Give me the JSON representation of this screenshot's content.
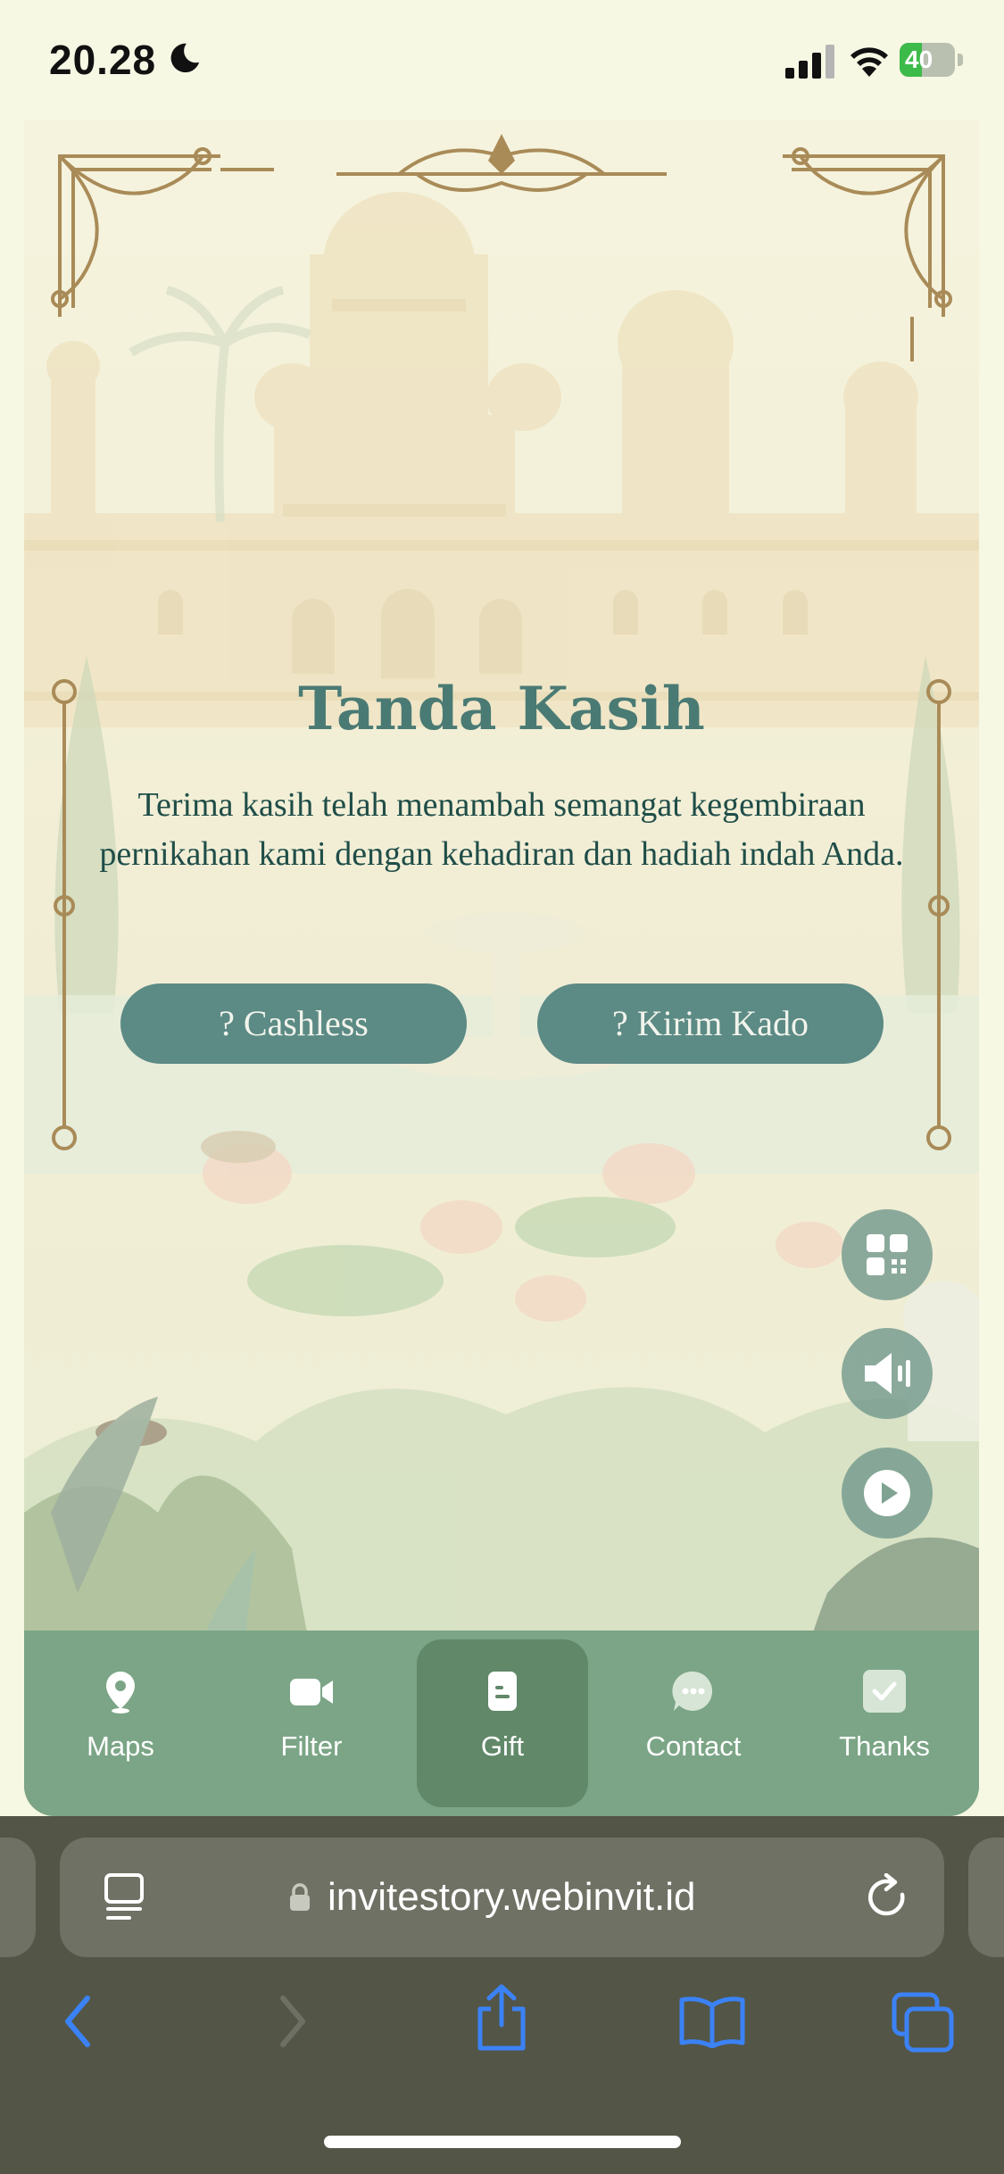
{
  "status_bar": {
    "time": "20.28",
    "battery": "40",
    "battery_level": 0.4
  },
  "invitation": {
    "title": "Tanda Kasih",
    "message": "Terima kasih telah menambah semangat kegembiraan pernikahan kami dengan kehadiran dan hadiah indah Anda.",
    "buttons": {
      "cashless": "? Cashless",
      "kirim_kado": "? Kirim Kado"
    }
  },
  "bottom_nav": {
    "active": "Gift",
    "items": [
      {
        "label": "Maps",
        "icon": "map-pin-icon"
      },
      {
        "label": "Filter",
        "icon": "video-camera-icon"
      },
      {
        "label": "Gift",
        "icon": "gift-card-icon"
      },
      {
        "label": "Contact",
        "icon": "chat-bubble-icon"
      },
      {
        "label": "Thanks",
        "icon": "check-square-icon"
      }
    ]
  },
  "floating_buttons": [
    {
      "icon": "qr-code-icon"
    },
    {
      "icon": "speaker-icon"
    },
    {
      "icon": "play-icon"
    }
  ],
  "browser": {
    "url": "invitestory.webinvit.id"
  },
  "colors": {
    "accent": "#5c8a84",
    "nav_background": "#7ba586",
    "nav_active": "#608869",
    "title": "#4a7a74",
    "ornament_gold": "#a98b58",
    "safari_blue": "#3b82f6"
  }
}
